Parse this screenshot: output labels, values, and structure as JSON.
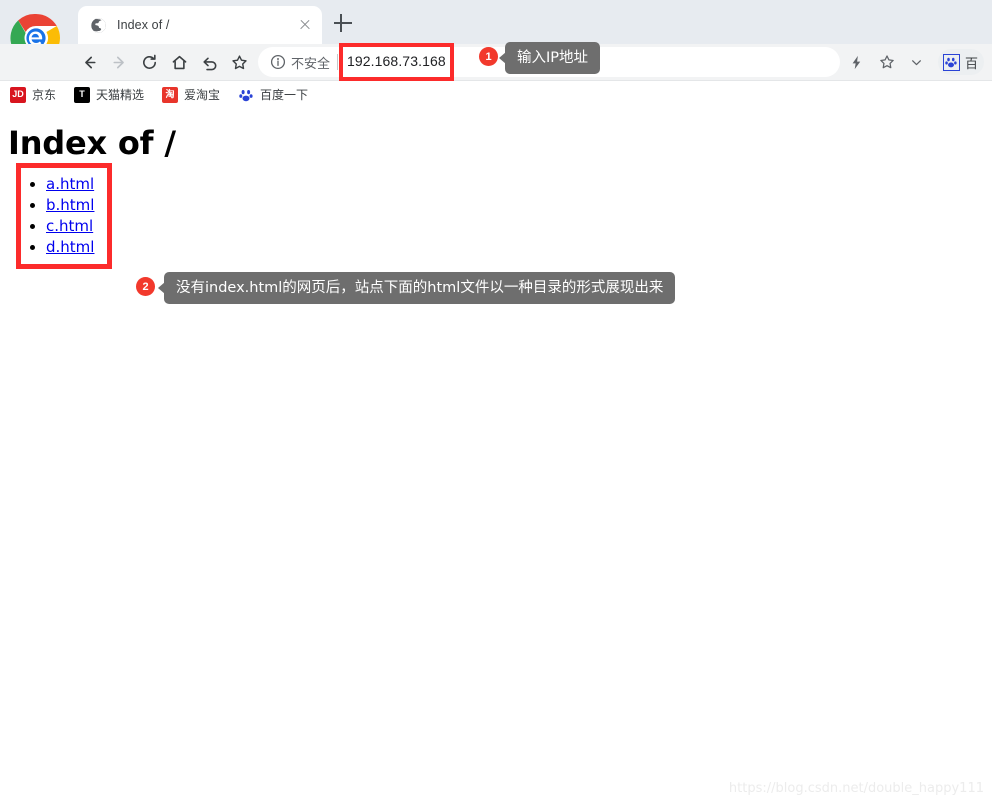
{
  "browser": {
    "logo_icon": "chrome-e-logo",
    "tab": {
      "title": "Index of /",
      "favicon_icon": "globe-favicon",
      "close_icon": "close-icon"
    },
    "new_tab_icon": "plus-icon",
    "nav": {
      "back_icon": "back-arrow-icon",
      "forward_icon": "forward-arrow-icon",
      "reload_icon": "reload-icon",
      "home_icon": "home-icon",
      "undo_icon": "undo-arrow-icon",
      "star_icon": "star-icon"
    },
    "omnibox": {
      "info_icon": "info-circle-icon",
      "security_label": "不安全",
      "url": "192.168.73.168",
      "highlight_color": "#fc2b2b"
    },
    "toolbar_right": {
      "lightning_icon": "lightning-bolt-icon",
      "bookmark_star_icon": "star-outline-icon",
      "chevron_icon": "chevron-down-icon",
      "extension": {
        "icon": "baidu-paw-icon",
        "label": "百"
      }
    },
    "bookmarks": [
      {
        "icon": "jd-icon",
        "icon_text": "JD",
        "label": "京东"
      },
      {
        "icon": "tmall-icon",
        "icon_text": "T",
        "label": "天猫精选"
      },
      {
        "icon": "taobao-icon",
        "icon_text": "淘",
        "label": "爱淘宝"
      },
      {
        "icon": "baidu-icon",
        "icon_text": "",
        "label": "百度一下"
      }
    ]
  },
  "page": {
    "heading": "Index of /",
    "links": [
      {
        "label": "a.html"
      },
      {
        "label": "b.html"
      },
      {
        "label": "c.html"
      },
      {
        "label": "d.html"
      }
    ],
    "link_color": "#0000ee",
    "watermark": "https://blog.csdn.net/double_happy111"
  },
  "annotations": [
    {
      "number": "1",
      "text": "输入IP地址"
    },
    {
      "number": "2",
      "text": "没有index.html的网页后，站点下面的html文件以一种目录的形式展现出来"
    }
  ]
}
